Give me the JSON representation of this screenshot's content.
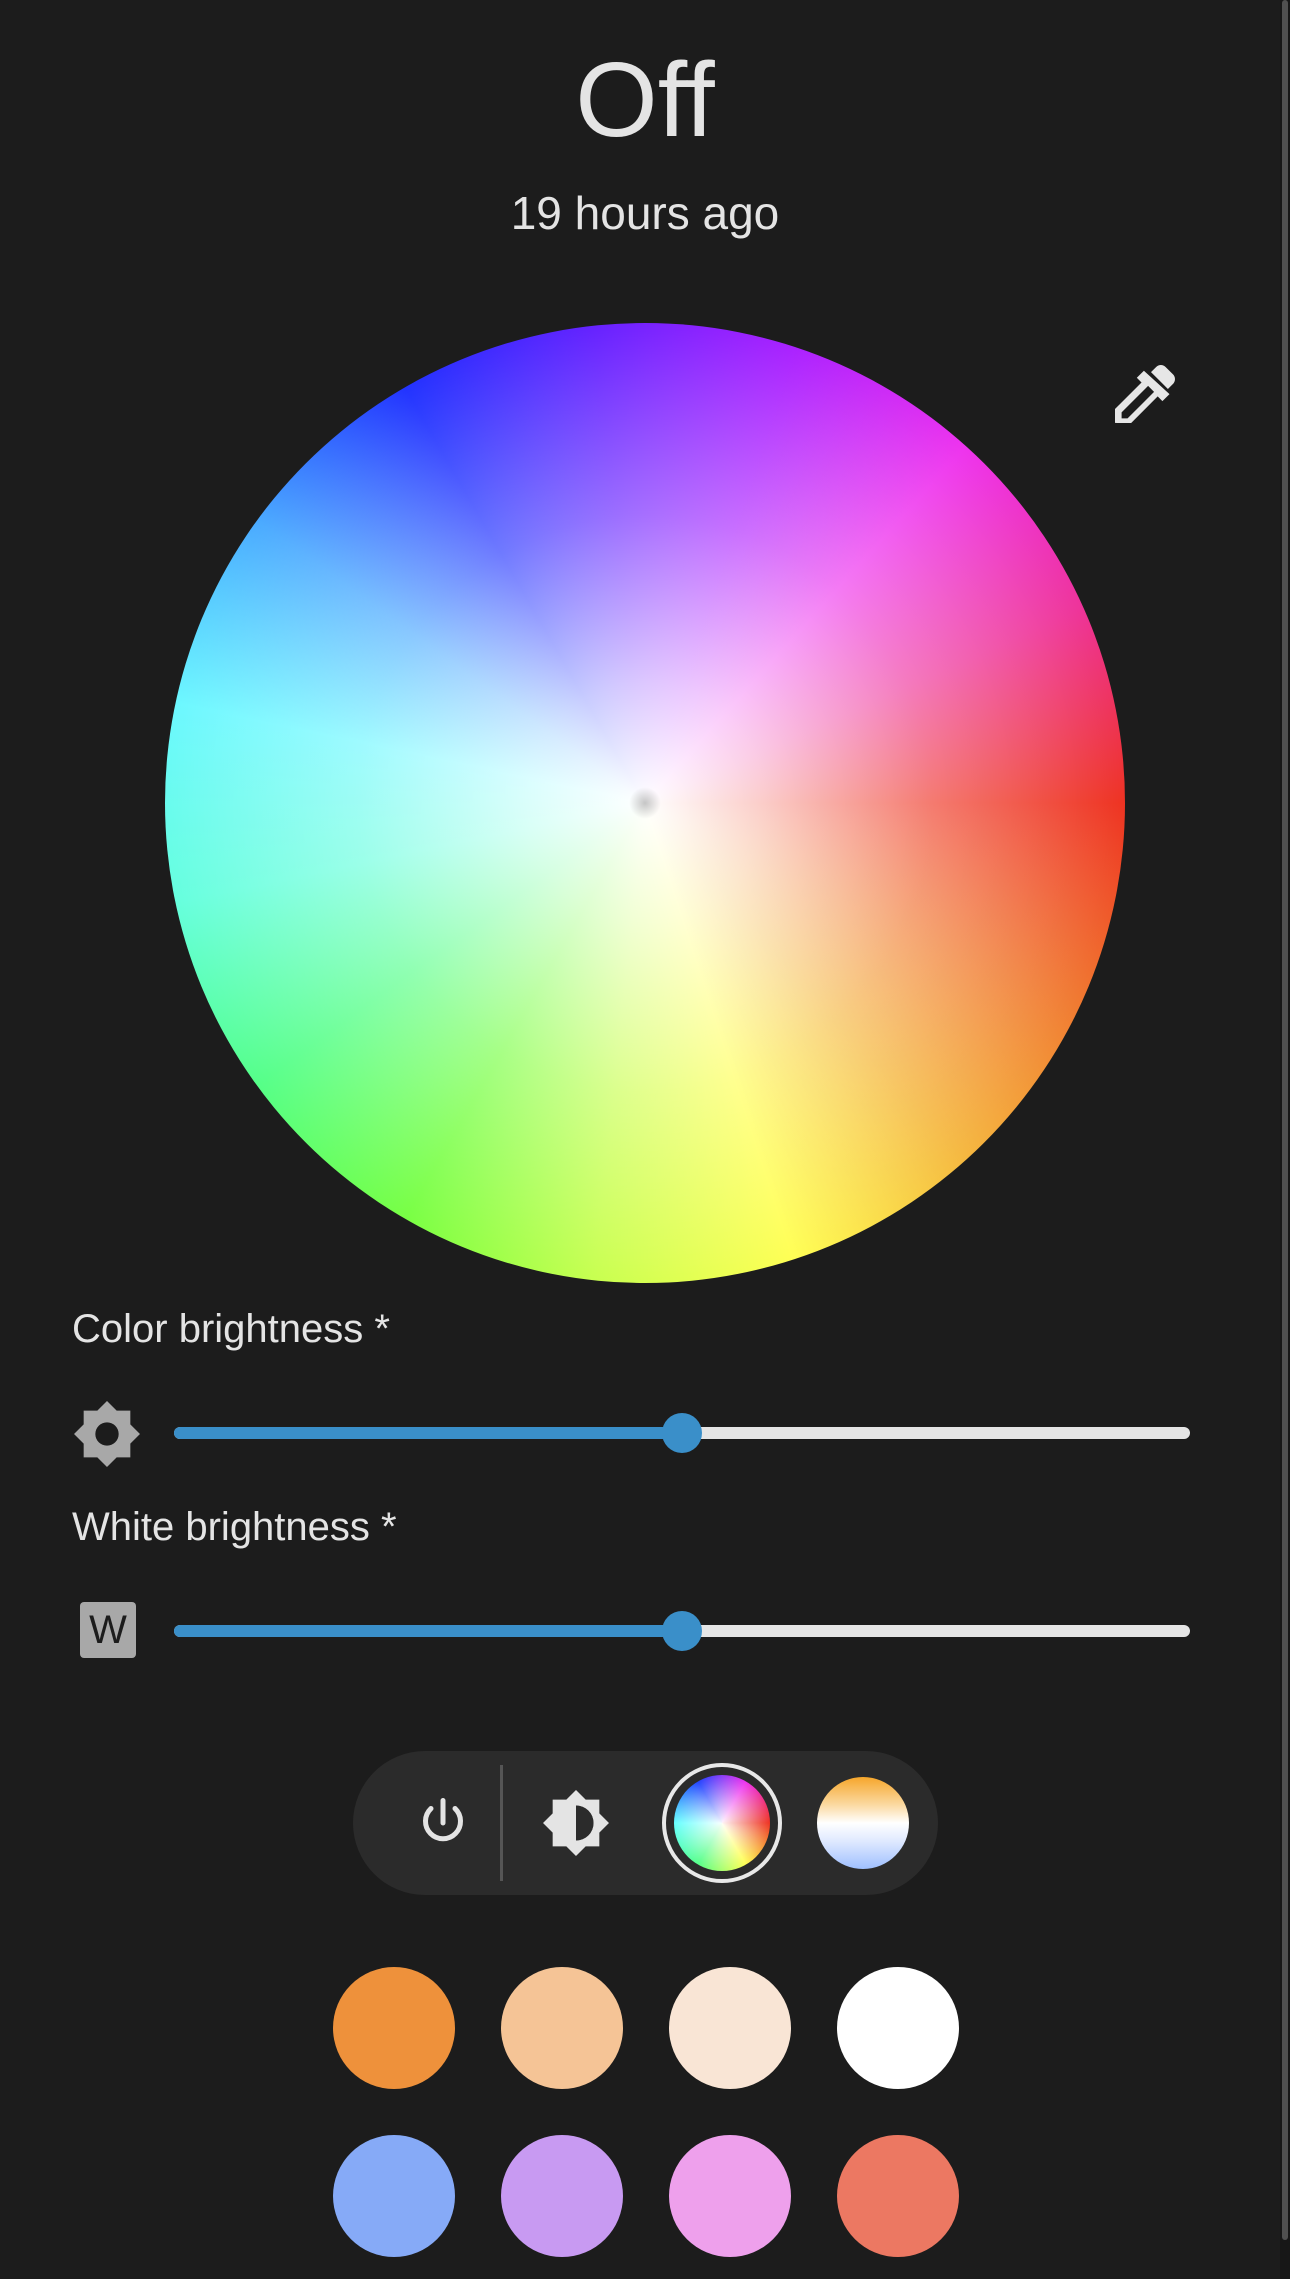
{
  "state": {
    "label": "Off",
    "last_changed": "19 hours ago"
  },
  "color_wheel": {
    "icon": "eyedropper-icon"
  },
  "color_brightness": {
    "label": "Color brightness *",
    "icon": "brightness-icon",
    "value_percent": 50
  },
  "white_brightness": {
    "label": "White brightness *",
    "icon_letter": "W",
    "value_percent": 50
  },
  "modes": {
    "power_icon": "power-icon",
    "brightness_icon": "brightness-half-icon",
    "color_icon": "color-wheel-icon",
    "temperature_icon": "color-temperature-icon",
    "selected": "color"
  },
  "colors": {
    "accent": "#3a8fc9",
    "background": "#1c1c1c"
  },
  "favorite_colors": [
    "#ee913b",
    "#f5c496",
    "#f9e5d5",
    "#ffffff",
    "#86aaf7",
    "#c89af2",
    "#eea0ec",
    "#ec7862"
  ]
}
